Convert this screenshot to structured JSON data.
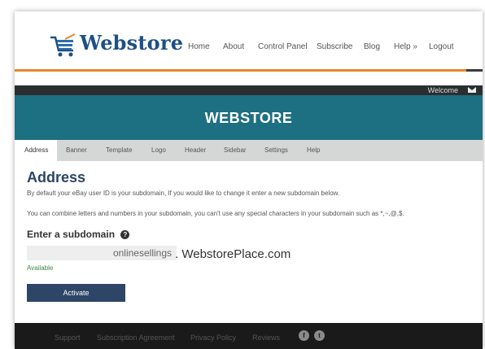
{
  "header": {
    "logo_text": "Webstore",
    "nav": [
      {
        "label": "Home"
      },
      {
        "label": "About"
      },
      {
        "label": "Control Panel"
      },
      {
        "label": "Subscribe"
      },
      {
        "label": "Blog"
      },
      {
        "label": "Help »"
      },
      {
        "label": "Logout"
      }
    ]
  },
  "welcome_bar": {
    "text": "Welcome",
    "icon": "mail-icon"
  },
  "banner": {
    "title": "WEBSTORE"
  },
  "tabs": [
    {
      "label": "Address",
      "active": true
    },
    {
      "label": "Banner"
    },
    {
      "label": "Template"
    },
    {
      "label": "Logo"
    },
    {
      "label": "Header"
    },
    {
      "label": "Sidebar"
    },
    {
      "label": "Settings"
    },
    {
      "label": "Help"
    }
  ],
  "content": {
    "title": "Address",
    "description_1": "By default your eBay user ID is your subdomain, If you would like to change it enter a new subdomain below.",
    "description_2": "You can combine letters and numbers in your subdomain, you can't use any special characters in your subdomain such as *,~,@,$.",
    "subheading": "Enter a subdomain",
    "subdomain_value": "onlinesellings",
    "domain_suffix": ". WebstorePlace.com",
    "availability": "Available",
    "activate_label": "Activate"
  },
  "footer": {
    "links": [
      {
        "label": "Support"
      },
      {
        "label": "Subscription Agreement"
      },
      {
        "label": "Privacy Policy"
      },
      {
        "label": "Reviews"
      }
    ],
    "social": [
      "facebook-icon",
      "twitter-icon"
    ]
  },
  "colors": {
    "accent_orange": "#e8862b",
    "banner_teal": "#1d6f82",
    "button_navy": "#2d4566",
    "available_green": "#3c8a4a"
  }
}
